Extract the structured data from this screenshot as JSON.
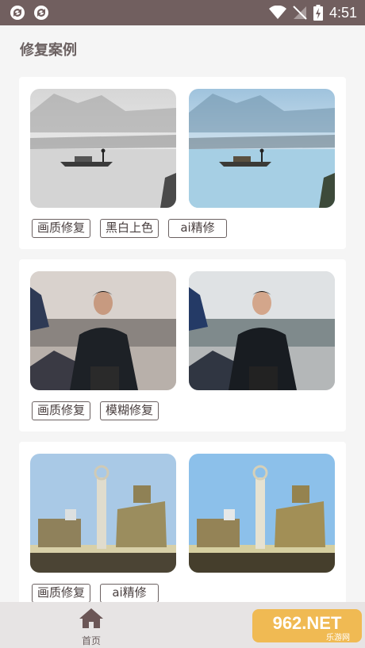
{
  "status_bar": {
    "time": "4:51",
    "left_icons": [
      "sync-icon",
      "sync-icon"
    ],
    "right_icons": [
      "wifi-icon",
      "no-signal-icon",
      "battery-charging-icon"
    ]
  },
  "page": {
    "title": "修复案例"
  },
  "cases": [
    {
      "tags": [
        "画质修复",
        "黑白上色",
        "ai精修"
      ]
    },
    {
      "tags": [
        "画质修复",
        "模糊修复"
      ]
    },
    {
      "tags": [
        "画质修复",
        "ai精修"
      ]
    }
  ],
  "tabbar": {
    "home_label": "首页",
    "home_icon": "home-icon"
  },
  "watermark": {
    "brand": "962.NET",
    "subtitle": "乐游网"
  },
  "colors": {
    "status_bar": "#715f5f",
    "accent": "#6b6161",
    "background": "#f5f5f5",
    "tabbar": "#e7e4e4"
  }
}
